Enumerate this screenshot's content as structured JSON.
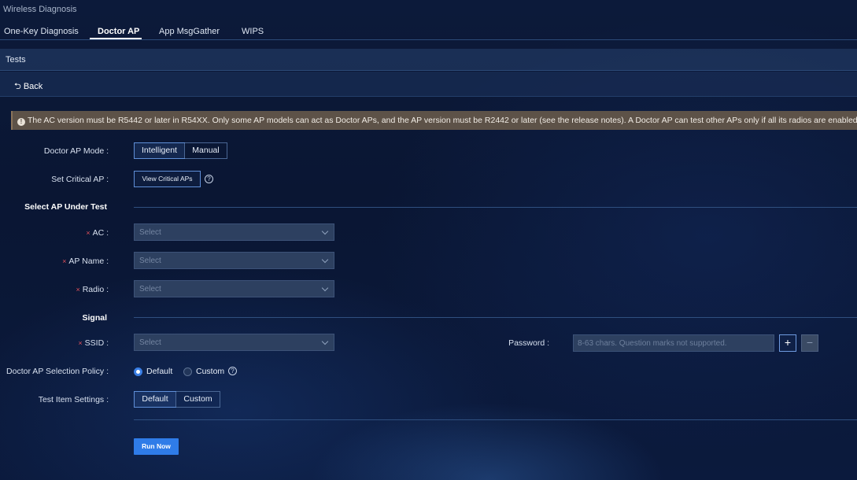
{
  "window": {
    "title": "Wireless Diagnosis"
  },
  "tabs": [
    {
      "label": "One-Key Diagnosis",
      "active": false
    },
    {
      "label": "Doctor AP",
      "active": true
    },
    {
      "label": "App MsgGather",
      "active": false
    },
    {
      "label": "WIPS",
      "active": false
    }
  ],
  "section": {
    "title": "Tests"
  },
  "nav": {
    "back_label": "Back"
  },
  "notice": {
    "icon": "warning-circle-icon",
    "text": "The AC version must be R5442 or later in R54XX. Only some AP models can act as Doctor APs, and the AP version must be R2442 or later (see the release notes). A Doctor AP can test other APs only if all its radios are enabled."
  },
  "form": {
    "doctor_ap_mode": {
      "label": "Doctor AP Mode :",
      "options": [
        "Intelligent",
        "Manual"
      ],
      "selected": "Intelligent"
    },
    "critical_ap": {
      "label": "Set Critical AP :",
      "button": "View Critical APs"
    },
    "select_ap_title": "Select AP Under Test",
    "ac": {
      "label": "AC :",
      "placeholder": "Select",
      "required": true
    },
    "ap_name": {
      "label": "AP Name :",
      "placeholder": "Select",
      "required": true
    },
    "radio": {
      "label": "Radio :",
      "placeholder": "Select",
      "required": true
    },
    "signal_title": "Signal",
    "ssid": {
      "label": "SSID :",
      "placeholder": "Select",
      "required": true
    },
    "password": {
      "label": "Password :",
      "placeholder": "8-63 chars. Question marks not supported."
    },
    "selection_policy": {
      "label": "Doctor AP Selection Policy :",
      "options": [
        "Default",
        "Custom"
      ],
      "selected": "Default"
    },
    "test_item_settings": {
      "label": "Test Item Settings :",
      "options": [
        "Default",
        "Custom"
      ],
      "selected": "Default"
    },
    "run_button": "Run Now",
    "required_mark": "×"
  },
  "colors": {
    "accent": "#2f7ce8",
    "background": "#0b1a3d",
    "notice_bg": "#5d5248",
    "required": "#e0505a"
  }
}
